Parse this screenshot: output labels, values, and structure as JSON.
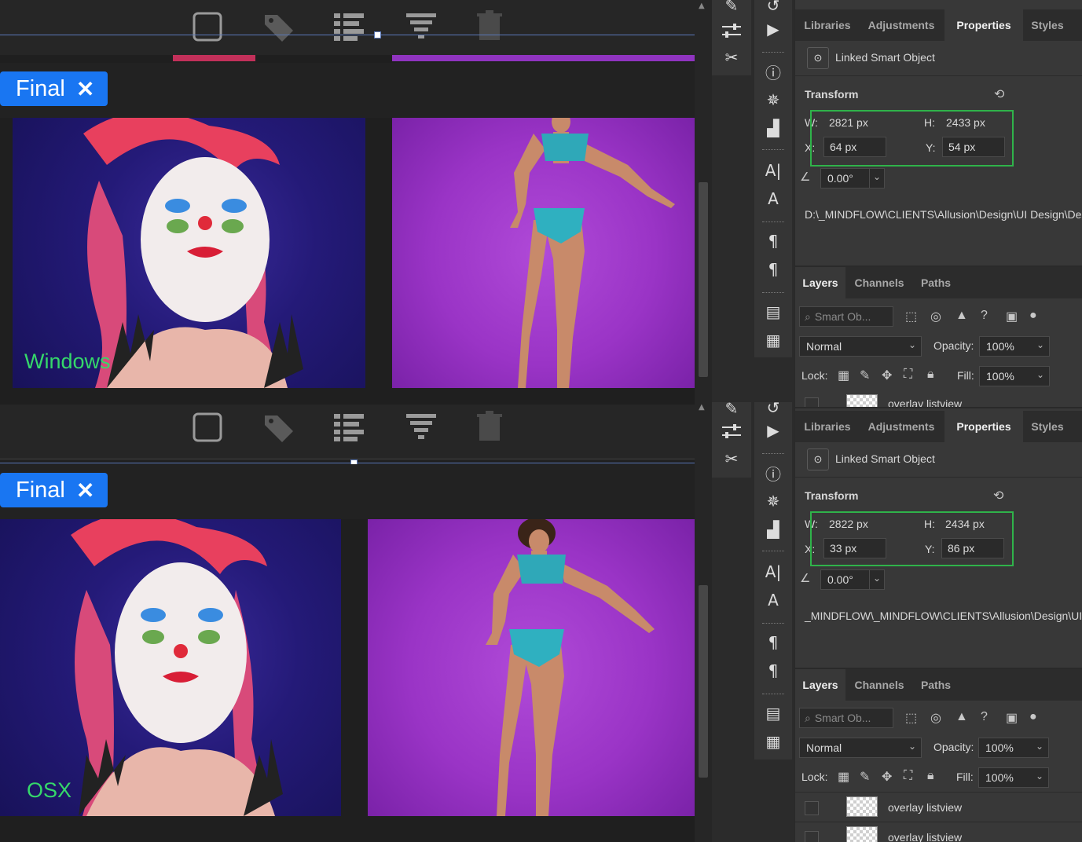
{
  "viewer": {
    "toolbar_icons": [
      "square-icon",
      "tag-icon",
      "list-view-icon",
      "filter-icon",
      "trash-icon"
    ],
    "tag_label": "Final",
    "tag_close_glyph": "✕",
    "top_label": "Windows",
    "bottom_label": "OSX",
    "label_color": "#35d86a",
    "tag_color": "#1976f2"
  },
  "panels": [
    {
      "tabs": [
        "Libraries",
        "Adjustments",
        "Properties",
        "Styles"
      ],
      "active_tab": "Properties",
      "object_type": "Linked Smart Object",
      "transform_title": "Transform",
      "w_label": "W:",
      "w_value": "2821 px",
      "h_label": "H:",
      "h_value": "2433 px",
      "x_label": "X:",
      "x_value": "64 px",
      "y_label": "Y:",
      "y_value": "54 px",
      "angle": "0.00°",
      "path": "D:\\_MINDFLOW\\CLIENTS\\Allusion\\Design\\UI   Design\\Des",
      "layer_tabs": [
        "Layers",
        "Channels",
        "Paths"
      ],
      "search_placeholder": "Smart Ob...",
      "blend_mode": "Normal",
      "opacity_label": "Opacity:",
      "opacity": "100%",
      "lock_label": "Lock:",
      "fill_label": "Fill:",
      "fill": "100%",
      "layers": [
        "overlay listview"
      ]
    },
    {
      "tabs": [
        "Libraries",
        "Adjustments",
        "Properties",
        "Styles"
      ],
      "active_tab": "Properties",
      "object_type": "Linked Smart Object",
      "transform_title": "Transform",
      "w_label": "W:",
      "w_value": "2822 px",
      "h_label": "H:",
      "h_value": "2434 px",
      "x_label": "X:",
      "x_value": "33 px",
      "y_label": "Y:",
      "y_value": "86 px",
      "angle": "0.00°",
      "path": "_MINDFLOW\\_MINDFLOW\\CLIENTS\\Allusion\\Design\\UI",
      "layer_tabs": [
        "Layers",
        "Channels",
        "Paths"
      ],
      "search_placeholder": "Smart Ob...",
      "blend_mode": "Normal",
      "opacity_label": "Opacity:",
      "opacity": "100%",
      "lock_label": "Lock:",
      "fill_label": "Fill:",
      "fill": "100%",
      "layers": [
        "overlay listview",
        "overlay listview"
      ]
    }
  ]
}
